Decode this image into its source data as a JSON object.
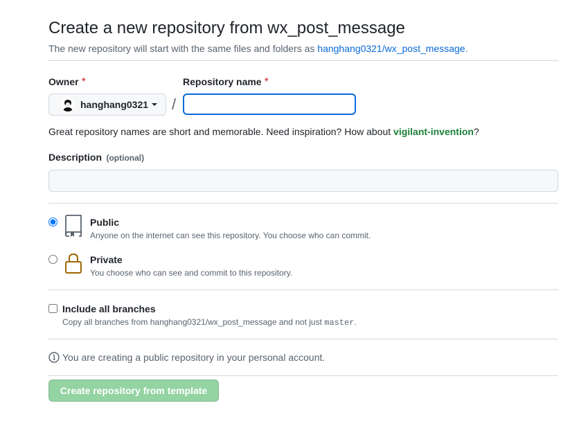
{
  "header": {
    "title": "Create a new repository from wx_post_message",
    "subtitle_prefix": "The new repository will start with the same files and folders as ",
    "template_link": "hanghang0321/wx_post_message",
    "subtitle_suffix": "."
  },
  "owner": {
    "label": "Owner",
    "required_mark": "*",
    "selected": "hanghang0321"
  },
  "separator": "/",
  "repo_name": {
    "label": "Repository name",
    "required_mark": "*",
    "value": "",
    "hint_prefix": "Great repository names are short and memorable. Need inspiration? How about ",
    "suggestion": "vigilant-invention",
    "hint_suffix": "?"
  },
  "description": {
    "label": "Description",
    "optional_label": "(optional)",
    "value": ""
  },
  "visibility": {
    "selected": "public",
    "options": [
      {
        "id": "public",
        "title": "Public",
        "description": "Anyone on the internet can see this repository. You choose who can commit.",
        "icon": "repo-icon"
      },
      {
        "id": "private",
        "title": "Private",
        "description": "You choose who can see and commit to this repository.",
        "icon": "lock-icon"
      }
    ]
  },
  "branches": {
    "label": "Include all branches",
    "checked": false,
    "desc_prefix": "Copy all branches from hanghang0321/wx_post_message and not just ",
    "desc_branch": "master",
    "desc_suffix": "."
  },
  "notice": {
    "icon": "info-icon",
    "text": "You are creating a public repository in your personal account."
  },
  "submit": {
    "label": "Create repository from template",
    "disabled": true
  },
  "colors": {
    "link": "#0969da",
    "suggestion": "#1a7f37",
    "required": "#d1242f",
    "submit_disabled_bg": "#94d3a2",
    "lock_icon": "#9a6700",
    "focus_border": "#0969da"
  }
}
